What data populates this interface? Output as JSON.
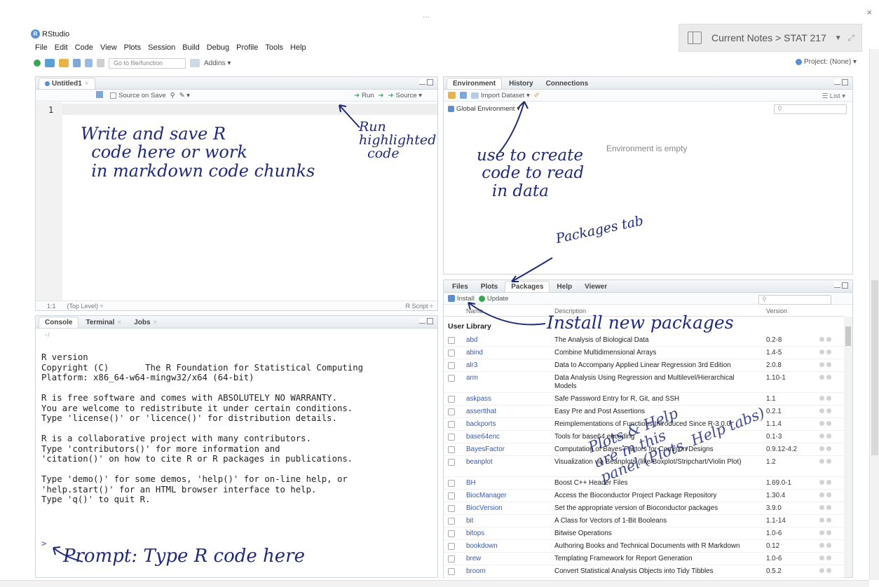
{
  "window": {
    "ellipsis": "...",
    "close": "×",
    "app_title": "RStudio",
    "logo_letter": "R"
  },
  "notes": {
    "label": "Current Notes > STAT 217",
    "caret": "▼",
    "expand": "⤢"
  },
  "menu": [
    "File",
    "Edit",
    "Code",
    "View",
    "Plots",
    "Session",
    "Build",
    "Debug",
    "Profile",
    "Tools",
    "Help"
  ],
  "toolbar": {
    "goto_placeholder": "Go to file/function",
    "addins": "Addins ▾",
    "project": "Project: (None) ▾"
  },
  "source": {
    "tab": "Untitled1",
    "source_on_save": "Source on Save",
    "run": "Run",
    "source_btn": "Source ▾",
    "line": "1",
    "status_pos": "1:1",
    "status_level": "(Top Level) ÷",
    "status_type": "R Script ÷"
  },
  "console": {
    "tabs": [
      "Console",
      "Terminal",
      "Jobs"
    ],
    "path": "~/",
    "text": "R version\nCopyright (C)       The R Foundation for Statistical Computing\nPlatform: x86_64-w64-mingw32/x64 (64-bit)\n\nR is free software and comes with ABSOLUTELY NO WARRANTY.\nYou are welcome to redistribute it under certain conditions.\nType 'license()' or 'licence()' for distribution details.\n\nR is a collaborative project with many contributors.\nType 'contributors()' for more information and\n'citation()' on how to cite R or R packages in publications.\n\nType 'demo()' for some demos, 'help()' for on-line help, or\n'help.start()' for an HTML browser interface to help.\nType 'q()' to quit R.",
    "prompt": ">"
  },
  "environment": {
    "tabs": [
      "Environment",
      "History",
      "Connections"
    ],
    "import": "Import Dataset ▾",
    "list": "☰ List ▾",
    "global": "Global Environment ▾",
    "empty": "Environment is empty"
  },
  "packages_pane": {
    "tabs": [
      "Files",
      "Plots",
      "Packages",
      "Help",
      "Viewer"
    ],
    "install": "Install",
    "update": "Update",
    "col_name": "Name",
    "col_desc": "Description",
    "col_version": "Version",
    "library": "User Library",
    "rows": [
      {
        "name": "abd",
        "desc": "The Analysis of Biological Data",
        "version": "0.2-8"
      },
      {
        "name": "abind",
        "desc": "Combine Multidimensional Arrays",
        "version": "1.4-5"
      },
      {
        "name": "alr3",
        "desc": "Data to Accompany Applied Linear Regression 3rd Edition",
        "version": "2.0.8"
      },
      {
        "name": "arm",
        "desc": "Data Analysis Using Regression and Multilevel/Hierarchical Models",
        "version": "1.10-1"
      },
      {
        "name": "askpass",
        "desc": "Safe Password Entry for R, Git, and SSH",
        "version": "1.1"
      },
      {
        "name": "assertthat",
        "desc": "Easy Pre and Post Assertions",
        "version": "0.2.1"
      },
      {
        "name": "backports",
        "desc": "Reimplementations of Functions Introduced Since R-3.0.0",
        "version": "1.1.4"
      },
      {
        "name": "base64enc",
        "desc": "Tools for base64 encoding",
        "version": "0.1-3"
      },
      {
        "name": "BayesFactor",
        "desc": "Computation of Bayes Factors for Common Designs",
        "version": "0.9.12-4.2"
      },
      {
        "name": "beanplot",
        "desc": "Visualization via Beanplots (like Boxplot/Stripchart/Violin Plot)",
        "version": "1.2"
      },
      {
        "name": "BH",
        "desc": "Boost C++ Header Files",
        "version": "1.69.0-1"
      },
      {
        "name": "BiocManager",
        "desc": "Access the Bioconductor Project Package Repository",
        "version": "1.30.4"
      },
      {
        "name": "BiocVersion",
        "desc": "Set the appropriate version of Bioconductor packages",
        "version": "3.9.0"
      },
      {
        "name": "bit",
        "desc": "A Class for Vectors of 1-Bit Booleans",
        "version": "1.1-14"
      },
      {
        "name": "bitops",
        "desc": "Bitwise Operations",
        "version": "1.0-6"
      },
      {
        "name": "bookdown",
        "desc": "Authoring Books and Technical Documents with R Markdown",
        "version": "0.12"
      },
      {
        "name": "brew",
        "desc": "Templating Framework for Report Generation",
        "version": "1.0-6"
      },
      {
        "name": "broom",
        "desc": "Convert Statistical Analysis Objects into Tidy Tibbles",
        "version": "0.5.2"
      }
    ]
  },
  "annotations": {
    "write": "Write and save R\n  code here or work\n  in markdown code chunks",
    "run": "Run\nhighlighted\n  code",
    "import": "use to create\n code to read\n   in data",
    "packages_tab": "Packages tab",
    "install": "Install new packages",
    "plots": "Plots & Help\nare in this\npanel (Plots, Help tabs)",
    "prompt": "Prompt: Type R code here"
  },
  "colors": {
    "ink": "#1f2a78",
    "pane_border": "#cfd6de",
    "link": "#3559b8"
  }
}
